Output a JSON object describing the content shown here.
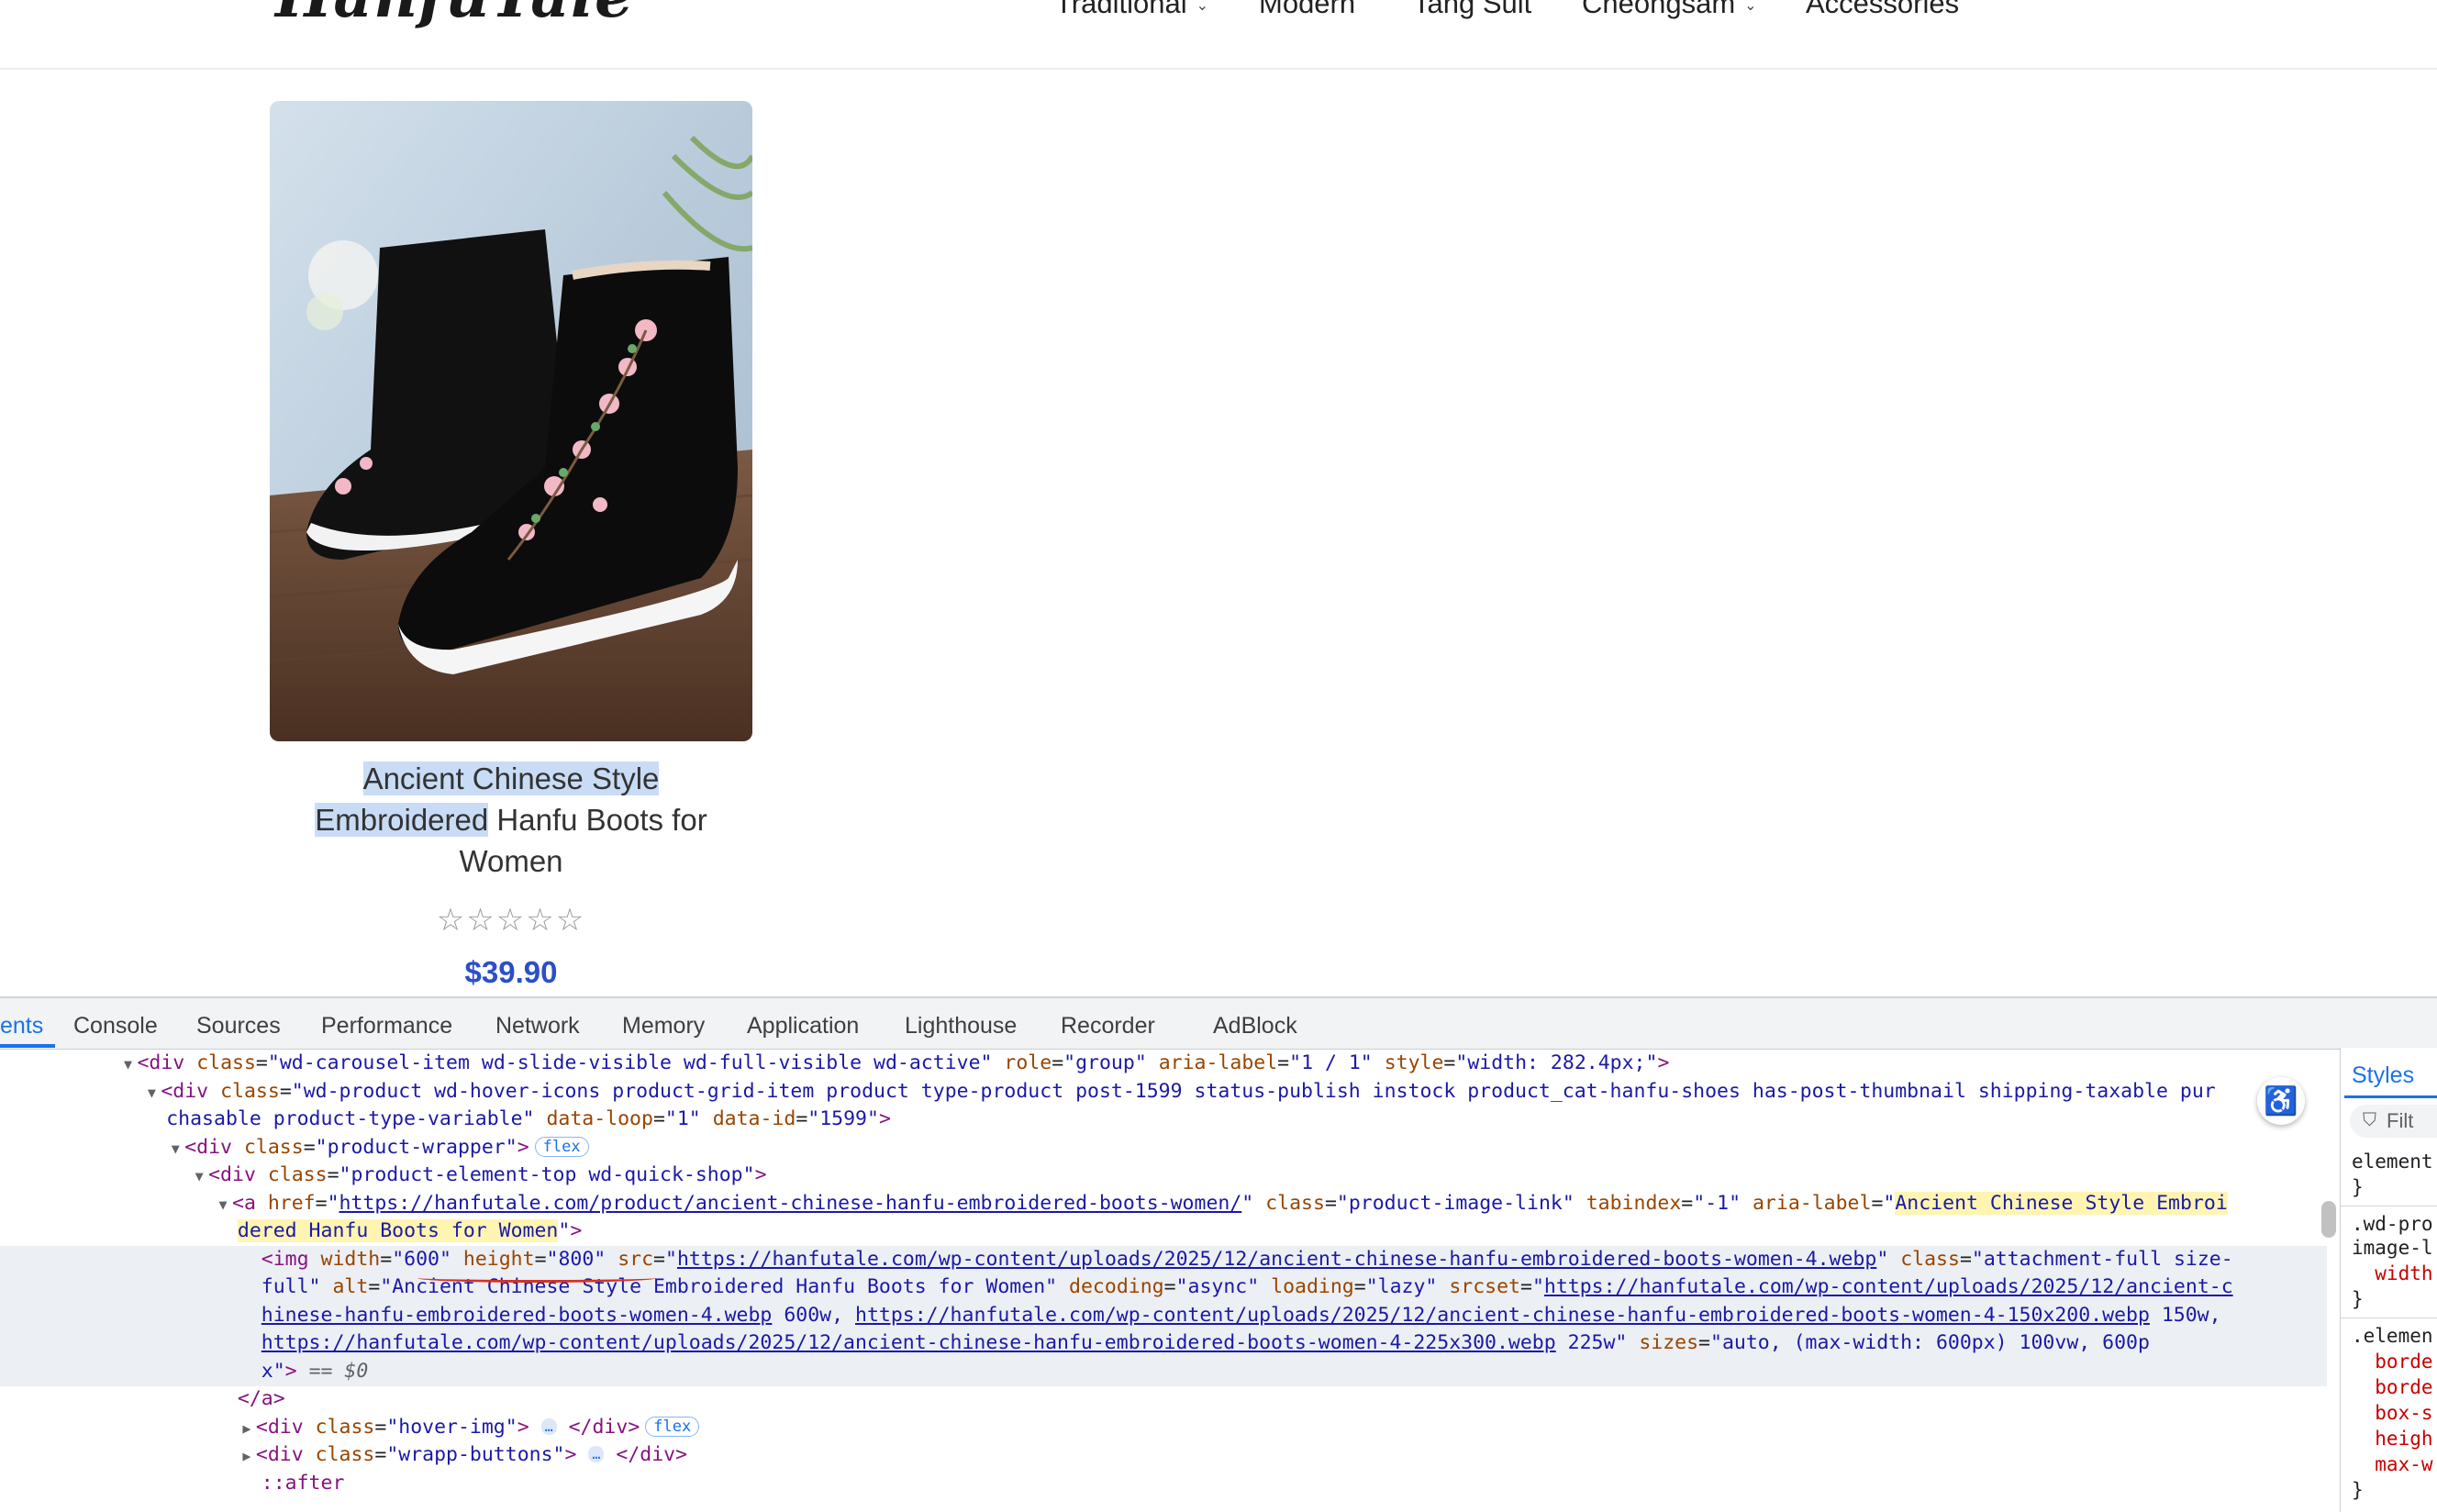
{
  "site": {
    "logo": "HanfuTale",
    "nav": [
      {
        "label": "Traditional",
        "has_caret": true
      },
      {
        "label": "Modern",
        "has_caret": false
      },
      {
        "label": "Tang Suit",
        "has_caret": false
      },
      {
        "label": "Cheongsam",
        "has_caret": true
      },
      {
        "label": "Accessories",
        "has_caret": false
      }
    ]
  },
  "product": {
    "title_part1": "Ancient Chinese Style",
    "title_part2": "Embroidered",
    "title_part3": " Hanfu Boots for Women",
    "rating_stars": 0,
    "rating_max": 5,
    "price": "$39.90"
  },
  "devtools": {
    "tabs": [
      "ents",
      "Console",
      "Sources",
      "Performance",
      "Network",
      "Memory",
      "Application",
      "Lighthouse",
      "Recorder",
      "AdBlock"
    ],
    "active_tab": "ents",
    "styles_tab": "Styles",
    "filter_placeholder": "Filt",
    "badges": {
      "flex": "flex",
      "ellipsis": "…"
    },
    "selected_marker": "== $0",
    "styles_lines": [
      "element",
      "}",
      ".wd-pro",
      "image-l",
      "  width",
      "}",
      ".elemen",
      "  borde",
      "  borde",
      "  box-s",
      "  heigh",
      "  max-w",
      "}"
    ]
  },
  "colors": {
    "accent": "#1a73e8",
    "price": "#2b4fc7",
    "selection": "#c9dcf5",
    "highlight": "#fff5b1"
  },
  "icons": [
    "caret-down-icon",
    "star-outline-icon",
    "accessibility-icon",
    "filter-icon"
  ]
}
